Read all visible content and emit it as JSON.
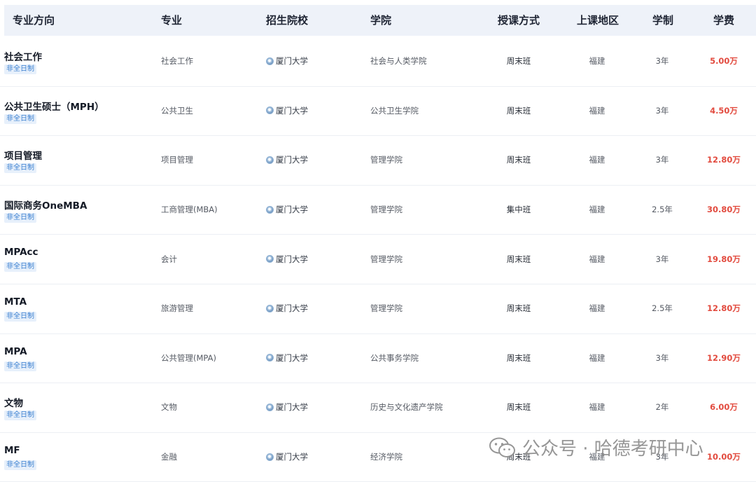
{
  "headers": {
    "major_direction": "专业方向",
    "major": "专业",
    "school": "招生院校",
    "college": "学院",
    "mode": "授课方式",
    "region": "上课地区",
    "duration": "学制",
    "fee": "学费"
  },
  "rows": [
    {
      "name": "社会工作",
      "badge": "非全日制",
      "major": "社会工作",
      "school": "厦门大学",
      "college": "社会与人类学院",
      "mode": "周末班",
      "region": "福建",
      "duration": "3年",
      "fee": "5.00万"
    },
    {
      "name": "公共卫生硕士（MPH）",
      "badge": "非全日制",
      "major": "公共卫生",
      "school": "厦门大学",
      "college": "公共卫生学院",
      "mode": "周末班",
      "region": "福建",
      "duration": "3年",
      "fee": "4.50万"
    },
    {
      "name": "项目管理",
      "badge": "非全日制",
      "major": "项目管理",
      "school": "厦门大学",
      "college": "管理学院",
      "mode": "周末班",
      "region": "福建",
      "duration": "3年",
      "fee": "12.80万"
    },
    {
      "name": "国际商务OneMBA",
      "badge": "非全日制",
      "major": "工商管理(MBA)",
      "school": "厦门大学",
      "college": "管理学院",
      "mode": "集中班",
      "region": "福建",
      "duration": "2.5年",
      "fee": "30.80万"
    },
    {
      "name": "MPAcc",
      "badge": "非全日制",
      "major": "会计",
      "school": "厦门大学",
      "college": "管理学院",
      "mode": "周末班",
      "region": "福建",
      "duration": "3年",
      "fee": "19.80万"
    },
    {
      "name": "MTA",
      "badge": "非全日制",
      "major": "旅游管理",
      "school": "厦门大学",
      "college": "管理学院",
      "mode": "周末班",
      "region": "福建",
      "duration": "2.5年",
      "fee": "12.80万"
    },
    {
      "name": "MPA",
      "badge": "非全日制",
      "major": "公共管理(MPA)",
      "school": "厦门大学",
      "college": "公共事务学院",
      "mode": "周末班",
      "region": "福建",
      "duration": "3年",
      "fee": "12.90万"
    },
    {
      "name": "文物",
      "badge": "非全日制",
      "major": "文物",
      "school": "厦门大学",
      "college": "历史与文化遗产学院",
      "mode": "周末班",
      "region": "福建",
      "duration": "2年",
      "fee": "6.00万"
    },
    {
      "name": "MF",
      "badge": "非全日制",
      "major": "金融",
      "school": "厦门大学",
      "college": "经济学院",
      "mode": "周末班",
      "region": "福建",
      "duration": "3年",
      "fee": "10.00万"
    }
  ],
  "watermark": "公众号 · 哈德考研中心",
  "colors": {
    "header_bg": "#eef2f9",
    "fee": "#e24b3f",
    "badge": "#3a7fd0"
  }
}
